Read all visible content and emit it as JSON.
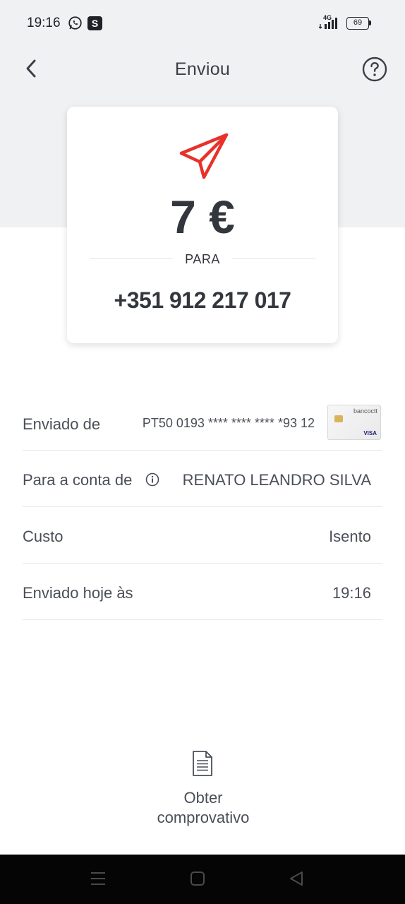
{
  "status_bar": {
    "time": "19:16",
    "app_badge": "S",
    "network": "4G",
    "battery": "69"
  },
  "header": {
    "title": "Enviou"
  },
  "summary": {
    "amount": "7 €",
    "para": "PARA",
    "recipient_phone": "+351 912 217 017",
    "accent_color": "#e8312a"
  },
  "details": {
    "from": {
      "label": "Enviado de",
      "value": "PT50 0193 **** **** **** *93 12"
    },
    "account": {
      "label": "Para a conta de",
      "value": "RENATO LEANDRO SILVA"
    },
    "cost": {
      "label": "Custo",
      "value": "Isento"
    },
    "sent": {
      "label": "Enviado hoje às",
      "value": "19:16"
    }
  },
  "card_thumb": {
    "brand": "bancoctt",
    "network": "VISA"
  },
  "receipt": {
    "label_line1": "Obter",
    "label_line2": "comprovativo"
  }
}
